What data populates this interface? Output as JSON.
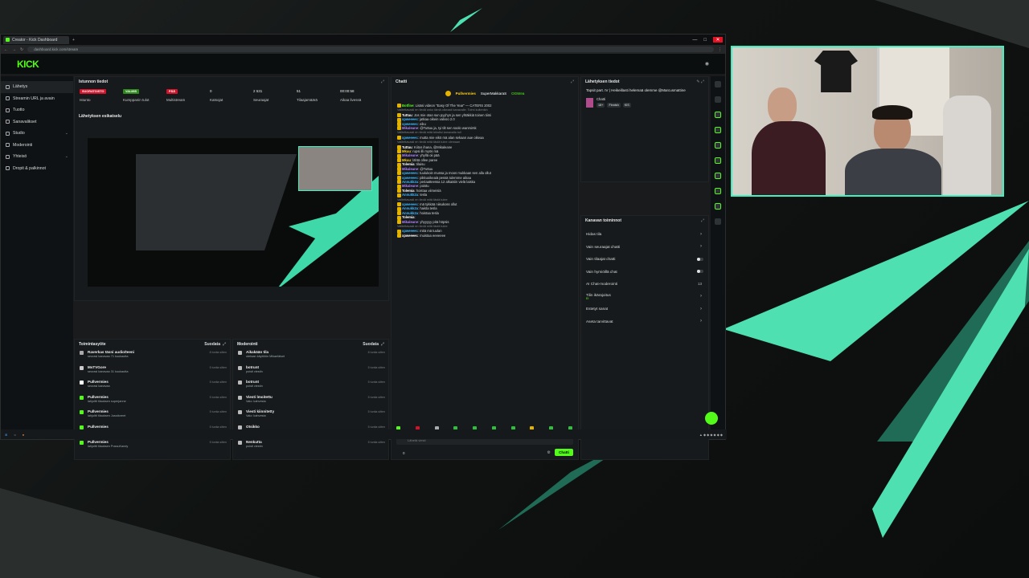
{
  "browser": {
    "tab_title": "Creator - Kick Dashboard",
    "url": "dashboard.kick.com/stream",
    "window_controls": [
      "—",
      "□",
      "✕"
    ]
  },
  "kick": {
    "logo": "KICK"
  },
  "sidebar": {
    "items": [
      {
        "label": "Lähetys",
        "icon": "broadcast-icon",
        "active": true
      },
      {
        "label": "Streamin URL ja avain",
        "icon": "key-icon"
      },
      {
        "label": "Tuotto",
        "icon": "money-icon"
      },
      {
        "label": "Sanavalikset",
        "icon": "list-icon"
      },
      {
        "label": "Studio",
        "icon": "studio-icon",
        "chevron": true
      },
      {
        "label": "Moderointi",
        "icon": "shield-icon"
      },
      {
        "label": "Yhteisö",
        "icon": "community-icon",
        "chevron": true
      },
      {
        "label": "Dropit & palkinnot",
        "icon": "gift-icon"
      }
    ]
  },
  "session": {
    "title": "Istunnon tiedot",
    "stats": [
      {
        "value": "SUORATOISTO",
        "label": "Istunto",
        "badge": true,
        "color": "#d4132a"
      },
      {
        "value": "VALMIS",
        "label": "Kumppanin tulot",
        "badge": true,
        "color": "#2f8a1e"
      },
      {
        "value": "PÄÄ",
        "label": "Multistream",
        "badge": true,
        "color": "#d4132a"
      },
      {
        "value": "0",
        "label": "Katsojat"
      },
      {
        "value": "2 531",
        "label": "Seuraajat"
      },
      {
        "value": "51",
        "label": "Tilaajamäärä"
      },
      {
        "value": "00:00:58",
        "label": "Aikaa livessä"
      }
    ]
  },
  "preview": {
    "title": "Lähetyksen esikatselu"
  },
  "activity": {
    "title": "Toimintasyöte",
    "action": "Suodata",
    "items": [
      {
        "name": "Raverkas täsni audio/teeni",
        "desc": "seurasi kanavaa 71 kuukautta",
        "time": "8 tuntia sitten",
        "color": "#aaaaaa"
      },
      {
        "name": "MsTVGore",
        "desc": "seurasi kanavaa 31 kuukautta",
        "time": "5 tuntia sitten",
        "color": "#cccccc"
      },
      {
        "name": "Pullvermies",
        "desc": "seurasi kanavaa",
        "time": "5 tuntia sitten",
        "color": "#ffffff"
      },
      {
        "name": "Pullvermies",
        "desc": "lahjoitti tilauksen superjanne",
        "time": "5 tuntia sitten",
        "color": "#53fc18"
      },
      {
        "name": "Pullvermies",
        "desc": "lahjoitti tilauksen Jussitoreet",
        "time": "5 tuntia sitten",
        "color": "#53fc18"
      },
      {
        "name": "Pullvermies",
        "desc": "lahjoitti tilauksen Mikaleane",
        "time": "5 tuntia sitten",
        "color": "#53fc18"
      },
      {
        "name": "Pullvermies",
        "desc": "lahjoitti tilauksen PossuKandy",
        "time": "5 tuntia sitten",
        "color": "#53fc18"
      }
    ]
  },
  "modlog": {
    "title": "Moderointi",
    "action": "Suodata",
    "items": [
      {
        "name": "Aikakään tila",
        "desc": "otetaan käyttöön Mikaeläiset",
        "time": "8 tuntia sitten"
      },
      {
        "name": "botrunt",
        "desc": "poisti viestin",
        "time": "5 tuntia sitten"
      },
      {
        "name": "botrunt",
        "desc": "poisti viestin",
        "time": "5 tuntia sitten"
      },
      {
        "name": "Viesti lmoitettu",
        "desc": "Valo: kahvesta",
        "time": "5 tuntia sitten"
      },
      {
        "name": "Viesti kiinnitetty",
        "desc": "Valo: kahvesta",
        "time": "5 tuntia sitten"
      },
      {
        "name": "Otsikko",
        "desc": "Tapsit part. III | Heikeillasti helemaä olemme Marcus Mattine",
        "time": "5 tuntia sitten"
      },
      {
        "name": "Nenkutta",
        "desc": "poisti viestin",
        "time": "5 tuntia sitten"
      }
    ]
  },
  "chat": {
    "title": "Chatti",
    "pinned_user": "Pullvermies",
    "pinned_user2": "SuperMakkaraS",
    "pinned_sub": "OGWea",
    "lines": [
      {
        "user": "Botfine",
        "text": "Lisäsi videon \"Easy Of The Year\" — CATERS 2002",
        "color": "#53fc18"
      },
      {
        "user": "",
        "text": "Valitettavasti en tiedä onko tämä oikeasti kanavalle. Toimi kuitenkin",
        "color": "#7d8387",
        "sys": true
      },
      {
        "user": "Tuttuu",
        "text": "Jos mie otan sun pyyhyn ja sen yhtäkkiä toinen tiimi",
        "color": "#ffffff"
      },
      {
        "user": "xpweeeec",
        "text": "jatkaa oikein valvoo 2.0",
        "color": "#3db9ff"
      },
      {
        "user": "xpweeeec",
        "text": "eiku",
        "color": "#3db9ff"
      },
      {
        "user": "Mikaleane",
        "text": "@Tuttuu ja, tyi tilt sen soolo wanmirsk",
        "color": "#b084ff"
      },
      {
        "user": "",
        "text": "Valitettavasti en tiedä mitä tekstisi kanavalla tuli",
        "color": "#7d8387",
        "sys": true
      },
      {
        "user": "xpweeeec",
        "text": "mutta mie eikö mä alan sekaan aue oikeaa",
        "color": "#3db9ff"
      },
      {
        "user": "",
        "text": "Valitettavasti en tiedä mitä tästä tulee olemaan",
        "color": "#7d8387",
        "sys": true
      },
      {
        "user": "Tuttuu",
        "text": "Kiitos ihana, @Mikaleane",
        "color": "#ffffff"
      },
      {
        "user": "Mkuu",
        "text": "rupsi illi myös mä",
        "color": "#ffd11a"
      },
      {
        "user": "Mikaleane",
        "text": "yhyllä oii pää",
        "color": "#b084ff"
      },
      {
        "user": "Mkuu",
        "text": "lähtä ollee paree",
        "color": "#ffd11a"
      },
      {
        "user": "Tolemia",
        "text": "tilaisu",
        "color": "#ffffff"
      },
      {
        "user": "Mikaleane",
        "text": "@Tuttuu",
        "color": "#b084ff"
      },
      {
        "user": "xpweeeec",
        "text": "tuulukoin mussa ja moos mukkaan sen alla ollut",
        "color": "#3db9ff"
      },
      {
        "user": "xpweeeec",
        "text": "pikkuoikeaiä pessä tulemme aikaa",
        "color": "#3db9ff"
      },
      {
        "user": "Annukk2a",
        "text": "periaatteessa 12 alkaisiin vielä laiska",
        "color": "#3db9ff"
      },
      {
        "user": "Mikaleane",
        "text": "poistu",
        "color": "#b084ff"
      },
      {
        "user": "Tolemia",
        "text": "hoistaa viimeisiä",
        "color": "#ffffff"
      },
      {
        "user": "Annukk2a",
        "text": "tesla",
        "color": "#3db9ff"
      },
      {
        "user": "",
        "text": "Valitettavasti en tiedä mitä tästä tulee",
        "color": "#7d8387",
        "sys": true
      },
      {
        "user": "xpweeeec",
        "text": "mä tykkää niisukoss ollut",
        "color": "#3db9ff"
      },
      {
        "user": "Annukk2a",
        "text": "haista tesla",
        "color": "#3db9ff"
      },
      {
        "user": "Annukk2a",
        "text": "hoistaa tesla",
        "color": "#3db9ff"
      },
      {
        "user": "Tolemia",
        "text": "",
        "color": "#ffffff"
      },
      {
        "user": "Mikaleane",
        "text": "yhyyyyy pitä höpsis",
        "color": "#b084ff"
      },
      {
        "user": "",
        "text": "Valitettavasti en tiedä mitä tästä tulee",
        "color": "#7d8387",
        "sys": true
      },
      {
        "user": "xpweeeec",
        "text": "mitä mä tuulan",
        "color": "#3db9ff"
      },
      {
        "user": "xpweeeec",
        "text": "muistaa eeeeeee",
        "color": "#ffffff"
      }
    ],
    "input_placeholder": "Lähetä viesti",
    "send_label": "Chatti",
    "viewer_count": "0"
  },
  "stream_info": {
    "title": "Lähetyksen tiedot",
    "stream_title": "Tapsit part. IV | Heikeillasti helemaä olemme @Marcusmattine",
    "category": "Chatti",
    "tags": [
      "18+",
      "Finnish",
      "KIS"
    ]
  },
  "mod_actions": {
    "title": "Kanavan toiminnot",
    "rows": [
      {
        "label": "Hidas tila",
        "type": "chevron"
      },
      {
        "label": "Vain seuraajat chatti",
        "type": "chevron"
      },
      {
        "label": "Vain tilaajat chatti",
        "type": "toggle"
      },
      {
        "label": "Vain hymiöillä chat",
        "type": "toggle"
      },
      {
        "label": "AI Chat-moderointi",
        "type": "value",
        "value": "13"
      },
      {
        "label": "Tilin ikärajoitus",
        "type": "chevron",
        "sub": "Ei"
      },
      {
        "label": "Estetyt sanat",
        "type": "chevron"
      },
      {
        "label": "Aseta tarvittavat",
        "type": "chevron"
      }
    ]
  },
  "colors": {
    "kick_green": "#53fc18",
    "teal": "#4ee0b0",
    "live_red": "#d4132a"
  }
}
